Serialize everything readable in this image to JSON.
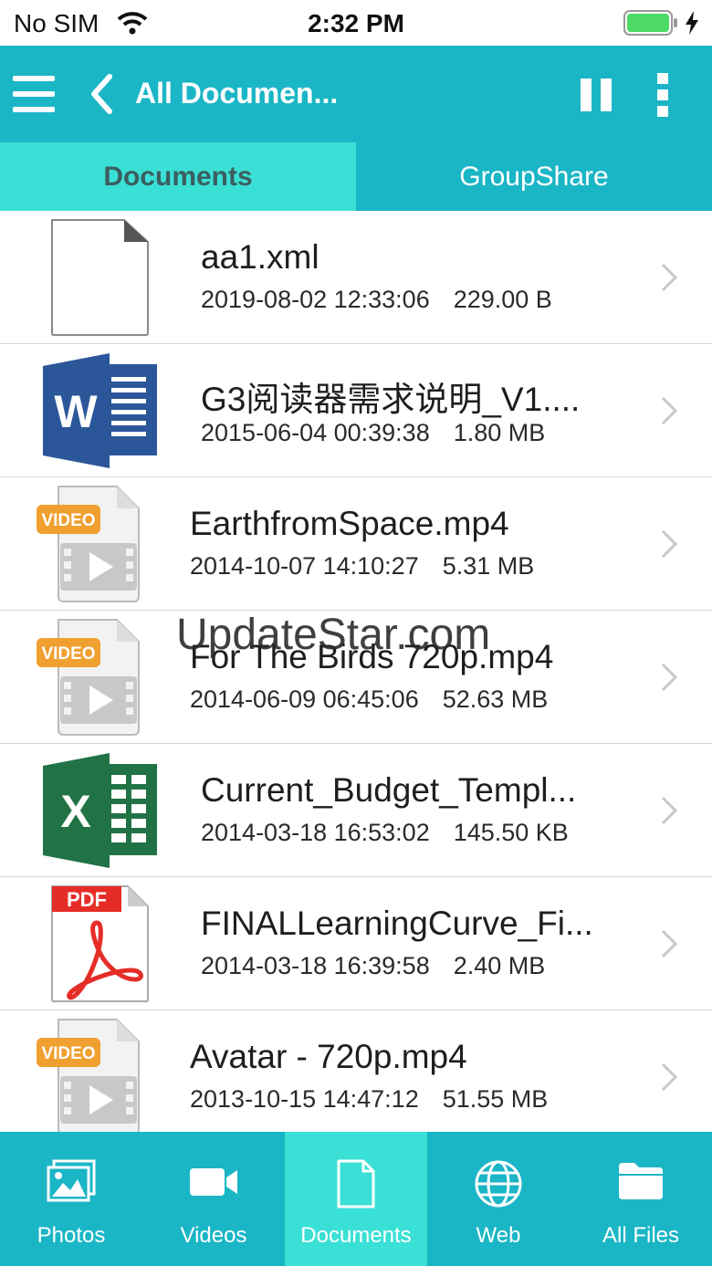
{
  "status_bar": {
    "carrier": "No SIM",
    "time": "2:32 PM"
  },
  "nav": {
    "title": "All Documen..."
  },
  "tabs": [
    {
      "label": "Documents",
      "active": true
    },
    {
      "label": "GroupShare",
      "active": false
    }
  ],
  "files": [
    {
      "name": "aa1.xml",
      "date": "2019-08-02 12:33:06",
      "size": "229.00 B",
      "icon": "blank-file-icon"
    },
    {
      "name": "G3阅读器需求说明_V1....",
      "date": "2015-06-04 00:39:38",
      "size": "1.80 MB",
      "icon": "word-icon"
    },
    {
      "name": "EarthfromSpace.mp4",
      "date": "2014-10-07 14:10:27",
      "size": "5.31 MB",
      "icon": "video-file-icon"
    },
    {
      "name": "For The Birds 720p.mp4",
      "date": "2014-06-09 06:45:06",
      "size": "52.63 MB",
      "icon": "video-file-icon"
    },
    {
      "name": "Current_Budget_Templ...",
      "date": "2014-03-18 16:53:02",
      "size": "145.50 KB",
      "icon": "excel-icon"
    },
    {
      "name": "FINALLearningCurve_Fi...",
      "date": "2014-03-18 16:39:58",
      "size": "2.40 MB",
      "icon": "pdf-icon"
    },
    {
      "name": "Avatar - 720p.mp4",
      "date": "2013-10-15 14:47:12",
      "size": "51.55 MB",
      "icon": "video-file-icon"
    }
  ],
  "icon_text": {
    "word": "W",
    "excel": "X",
    "pdf": "PDF",
    "video": "VIDEO"
  },
  "watermark": "UpdateStar.com",
  "tab_bar": [
    {
      "label": "Photos",
      "icon": "photos-icon"
    },
    {
      "label": "Videos",
      "icon": "video-camera-icon"
    },
    {
      "label": "Documents",
      "icon": "document-icon",
      "active": true
    },
    {
      "label": "Web",
      "icon": "globe-icon"
    },
    {
      "label": "All Files",
      "icon": "folder-icon"
    }
  ],
  "colors": {
    "primary": "#1ab6c6",
    "accent": "#3ae0d5",
    "word": "#2b579a",
    "excel": "#217346",
    "pdf": "#e52d27",
    "video": "#f0a030"
  }
}
